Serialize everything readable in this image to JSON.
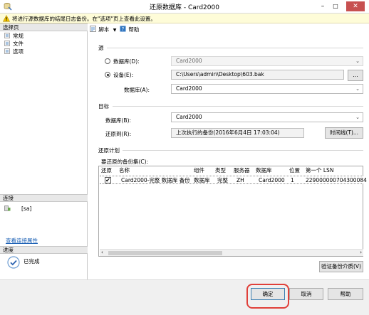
{
  "window": {
    "title": "还原数据库 - Card2000",
    "minimize": "–",
    "maximize": "□",
    "close": "✕"
  },
  "warning": {
    "text": "将进行源数据库的结尾日志备份。在\"选项\"页上查看此设置。"
  },
  "left_pane": {
    "select_page_header": "选择页",
    "pages": [
      {
        "label": "常规"
      },
      {
        "label": "文件"
      },
      {
        "label": "选项"
      }
    ],
    "connection_header": "连接",
    "connection_user": "[sa]",
    "view_connection_properties": "查看连接属性",
    "progress_header": "进度",
    "progress_status": "已完成"
  },
  "toolbar": {
    "script": "脚本",
    "help": "帮助"
  },
  "source": {
    "section": "源",
    "database_radio": "数据库(D):",
    "database_value": "Card2000",
    "device_radio": "设备(E):",
    "device_value": "C:\\Users\\admin\\Desktop\\603.bak",
    "browse_button": "...",
    "device_database_label": "数据库(A):",
    "device_database_value": "Card2000"
  },
  "destination": {
    "section": "目标",
    "database_label": "数据库(B):",
    "database_value": "Card2000",
    "restore_to_label": "还原到(R):",
    "restore_to_value": "上次执行的备份(2016年6月4日 17:03:04)",
    "timeline_button": "时间线(T)..."
  },
  "restore_plan": {
    "section": "还原计划",
    "backup_sets_label": "要还原的备份集(C):",
    "columns": [
      "还原",
      "名称",
      "组件",
      "类型",
      "服务器",
      "数据库",
      "位置",
      "第一个 LSN"
    ],
    "rows": [
      {
        "restore": "✔",
        "name": "Card2000-完整 数据库 备份",
        "component": "数据库",
        "type": "完整",
        "server": "ZH",
        "database": "Card2000",
        "position": "1",
        "first_lsn": "229000000704300084"
      }
    ],
    "verify_button": "验证备份介质(V)"
  },
  "footer": {
    "ok": "确定",
    "cancel": "取消",
    "help": "帮助"
  },
  "colors": {
    "warning_bg": "#fefcd8",
    "highlight_ring": "#e0403a",
    "link": "#1a5fb4"
  }
}
